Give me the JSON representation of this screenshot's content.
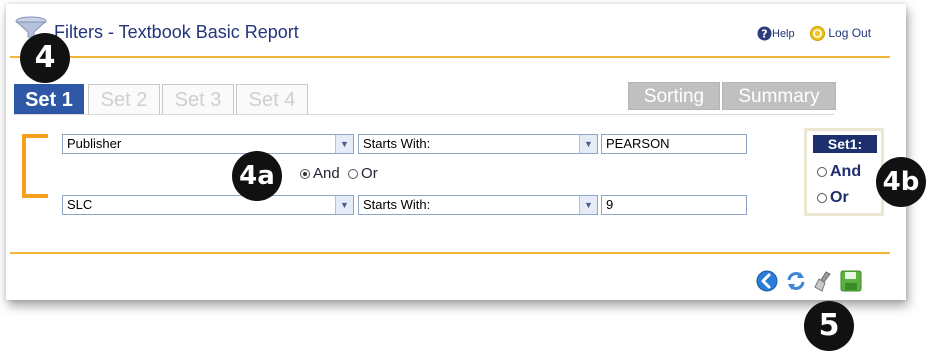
{
  "header": {
    "title": "Filters - Textbook Basic Report",
    "help_label": "Help",
    "logout_label": "Log Out"
  },
  "callouts": {
    "tabs": "4",
    "and_or": "4a",
    "set_and_or": "4b",
    "actions": "5"
  },
  "tabs": {
    "sets": [
      "Set 1",
      "Set 2",
      "Set 3",
      "Set 4"
    ],
    "active_set": "Set 1",
    "right": [
      "Sorting",
      "Summary"
    ]
  },
  "filters": [
    {
      "field": "Publisher",
      "operator": "Starts With:",
      "value": "PEARSON"
    },
    {
      "field": "SLC",
      "operator": "Starts With:",
      "value": "9"
    }
  ],
  "conjunction": {
    "and_label": "And",
    "or_label": "Or",
    "selected": "And"
  },
  "set_conjunction": {
    "header": "Set1:",
    "and_label": "And",
    "or_label": "Or"
  },
  "toolbar": {
    "icons": [
      "back-arrow-icon",
      "refresh-icon",
      "clear-broom-icon",
      "save-disk-icon"
    ]
  },
  "colors": {
    "accent": "#f4b43a",
    "active_tab": "#2e58a6",
    "title_text": "#22357a",
    "badge": "#111111"
  }
}
